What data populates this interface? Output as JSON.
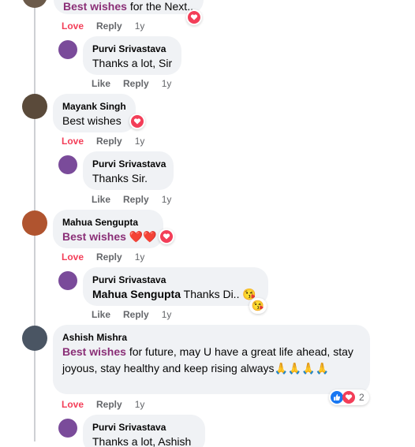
{
  "labels": {
    "love": "Love",
    "like": "Like",
    "reply": "Reply"
  },
  "comments": [
    {
      "author": "",
      "mention": "Best wishes",
      "text": " for the Next..",
      "time": "1y",
      "reacted": "Love"
    },
    {
      "author": "Purvi Srivastava",
      "text": "Thanks a lot, Sir",
      "time": "1y",
      "reacted": "Like"
    },
    {
      "author": "Mayank Singh",
      "text": "Best wishes",
      "time": "1y",
      "reacted": "Love"
    },
    {
      "author": "Purvi Srivastava",
      "text": "Thanks Sir.",
      "time": "1y",
      "reacted": "Like"
    },
    {
      "author": "Mahua Sengupta",
      "mention": "Best wishes",
      "text": " ❤️❤️",
      "time": "1y",
      "reacted": "Love"
    },
    {
      "author": "Purvi Srivastava",
      "mention": "Mahua Sengupta",
      "text": " Thanks Di.. 😘",
      "time": "1y",
      "reacted": "Like",
      "badge_emoji": "😘"
    },
    {
      "author": "Ashish Mishra",
      "mention": "Best wishes",
      "text": " for future, may U have a great life ahead, stay joyous, stay healthy and keep rising always🙏🙏🙏🙏",
      "time": "1y",
      "reacted": "Love",
      "reaction_count": "2"
    },
    {
      "author": "Purvi Srivastava",
      "text": "Thanks a lot, Ashish",
      "time": "",
      "reacted": ""
    }
  ],
  "colors": {
    "love": "#f33e58",
    "like": "#1877f2",
    "mention": "#8a2f77",
    "bubble": "#f0f2f5"
  }
}
